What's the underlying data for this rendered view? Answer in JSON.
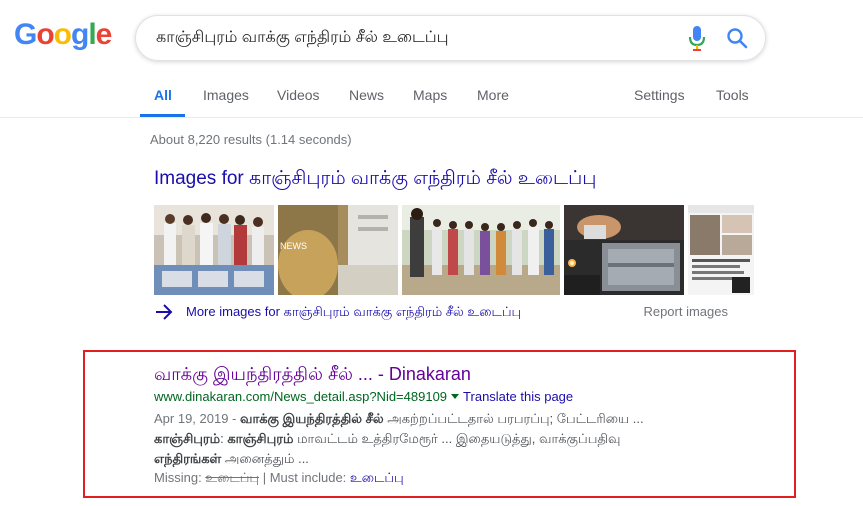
{
  "logo": {
    "letters": [
      "G",
      "o",
      "o",
      "g",
      "l",
      "e"
    ]
  },
  "search": {
    "query": "காஞ்சிபுரம் வாக்கு எந்திரம் சீல் உடைப்பு"
  },
  "icons": {
    "mic": "mic-icon",
    "search": "search-icon",
    "arrow": "arrow-right-icon"
  },
  "tabs": [
    {
      "label": "All"
    },
    {
      "label": "Images"
    },
    {
      "label": "Videos"
    },
    {
      "label": "News"
    },
    {
      "label": "Maps"
    },
    {
      "label": "More"
    },
    {
      "label": "Settings"
    },
    {
      "label": "Tools"
    }
  ],
  "stats": "About 8,220 results (1.14 seconds)",
  "images_section": {
    "header": "Images for காஞ்சிபுரம் வாக்கு எந்திரம் சீல் உடைப்பு",
    "thumb_watermark": "NEWS",
    "more_label": "More images for காஞ்சிபுரம் வாக்கு எந்திரம் சீல் உடைப்பு",
    "report_label": "Report images"
  },
  "result": {
    "title": "வாக்கு இயந்திரத்தில் சீல் ... - Dinakaran",
    "url": "www.dinakaran.com/News_detail.asp?Nid=489109",
    "translate": "Translate this page",
    "date": "Apr 19, 2019 - ",
    "line1_bold": "வாக்கு இயந்திரத்தில் சீல்",
    "line1_rest": " அகற்றப்பட்டதால் பரபரப்பு; பேட்டரியை ...",
    "line2_bold1": "காஞ்சிபுரம்",
    "line2_sep": ": ",
    "line2_bold2": "காஞ்சிபுரம்",
    "line2_rest": " மாவட்டம் உத்திரமேரூர் ... இதையடுத்து, வாக்குப்பதிவு",
    "line3_bold": "எந்திரங்கள்",
    "line3_rest": " அனைத்தும் ...",
    "missing_label": "Missing: ",
    "missing_term": "உடைப்பு",
    "must_label": " | Must include: ",
    "must_term": "உடைப்பு"
  },
  "colors": {
    "link": "#1a0dab",
    "visited": "#660099",
    "url_green": "#006621",
    "active_tab": "#1a73e8",
    "highlight_border": "#e02020"
  }
}
